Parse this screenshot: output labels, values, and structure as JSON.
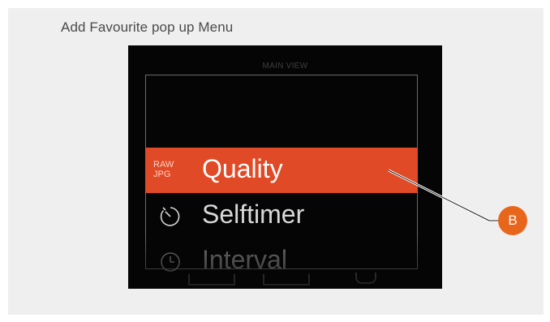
{
  "caption": "Add Favourite pop up Menu",
  "screen": {
    "header_label": "MAIN VIEW",
    "menu": [
      {
        "label": "Quality",
        "icon": "raw-jpg-icon",
        "icon_text": [
          "RAW",
          "JPG"
        ],
        "selected": true
      },
      {
        "label": "Selftimer",
        "icon": "selftimer-icon",
        "selected": false
      },
      {
        "label": "Interval",
        "icon": "interval-clock-icon",
        "selected": false
      }
    ]
  },
  "callout": {
    "badge": "B"
  },
  "colors": {
    "selected_row": "#e04a26",
    "badge": "#e8661c",
    "screen_bg": "#050505"
  }
}
